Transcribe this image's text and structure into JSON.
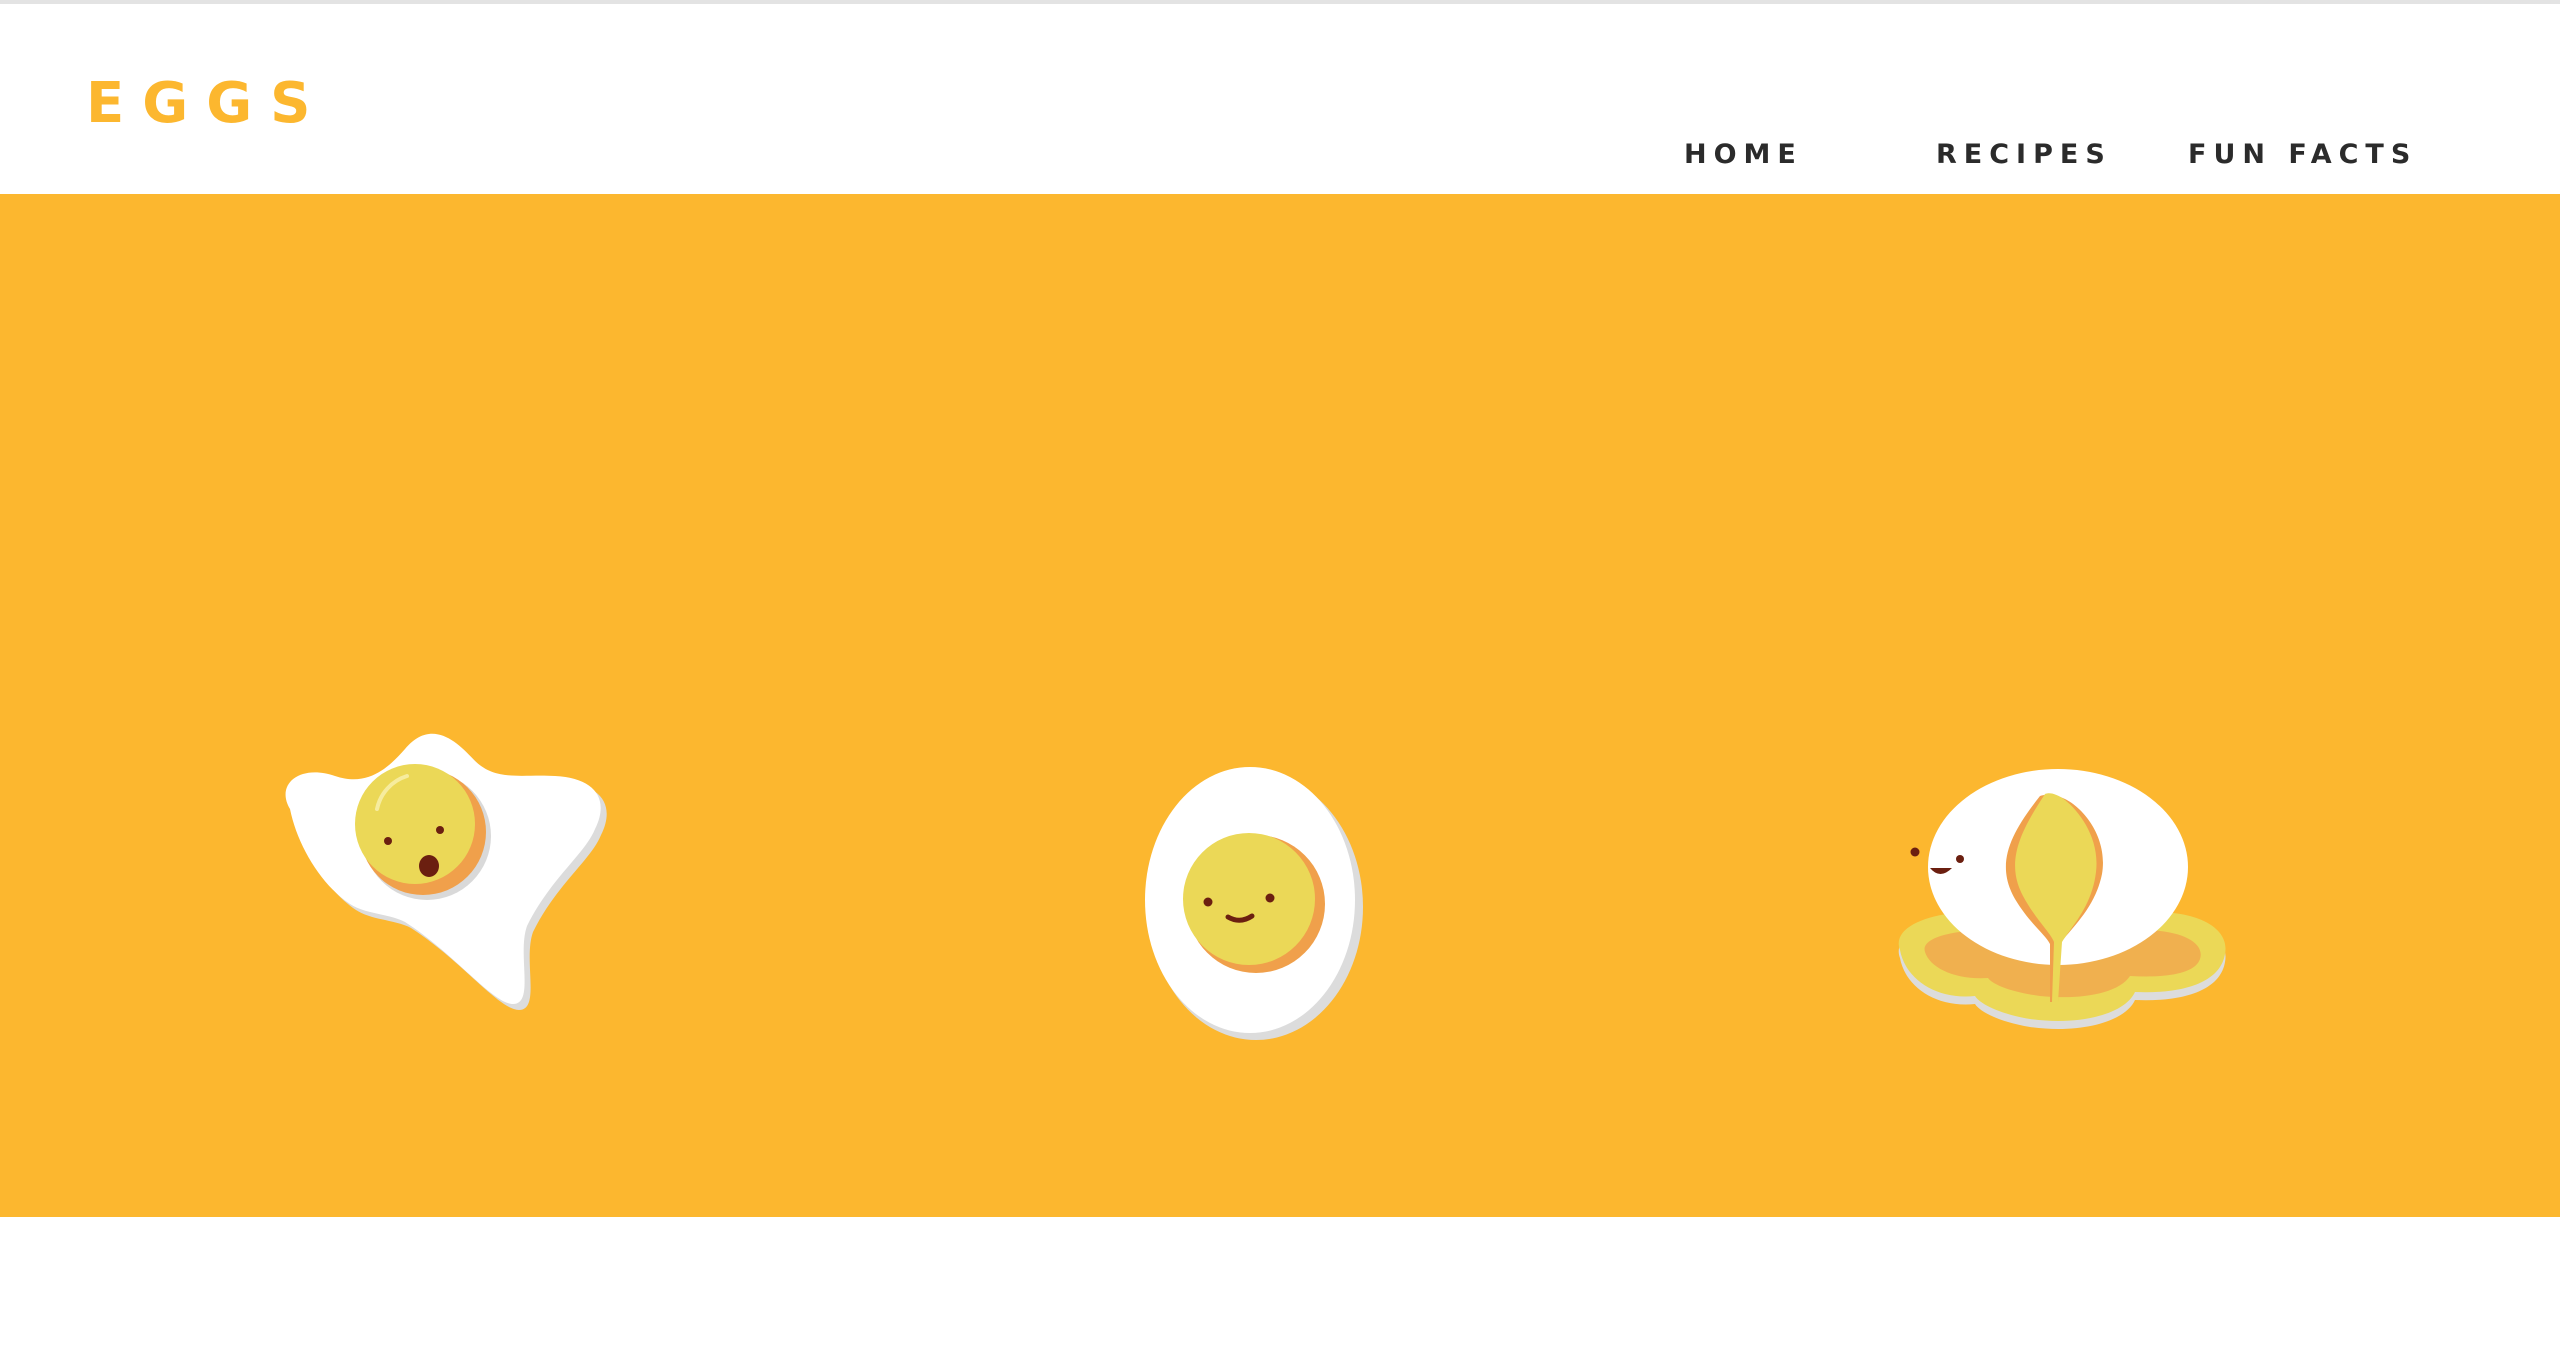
{
  "brand": {
    "name": "EGGS",
    "color": "#fcb72f"
  },
  "nav": {
    "items": [
      {
        "label": "HOME"
      },
      {
        "label": "RECIPES"
      },
      {
        "label": "FUN FACTS"
      }
    ]
  },
  "hero": {
    "background": "#fcb72f",
    "illustrations": [
      {
        "icon": "fried-egg-icon",
        "expression": "surprised"
      },
      {
        "icon": "boiled-egg-icon",
        "expression": "smiling"
      },
      {
        "icon": "poached-egg-icon",
        "expression": "smiling"
      }
    ]
  },
  "colors": {
    "nav_text": "#2b2b2b",
    "egg_white": "#ffffff",
    "yolk": "#ebd857",
    "yolk_shadow": "#f0a04b",
    "face": "#6b1f10"
  }
}
